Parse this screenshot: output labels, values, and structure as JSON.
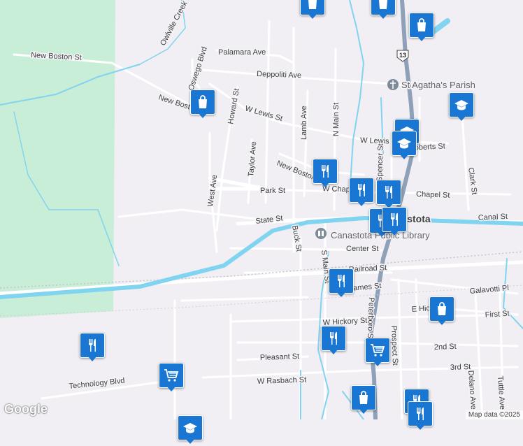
{
  "map": {
    "attribution": "Map data ©2025",
    "logo": "Google",
    "colors": {
      "land": "#f1eff3",
      "park": "#c9eed8",
      "water": "#80d4f0",
      "road": "#ffffff",
      "highway": "#8ea1b8",
      "marker": "#1976d2"
    },
    "streets": [
      "Owlville Creek",
      "New Boston St",
      "Palamara Ave",
      "Deppoliti Ave",
      "Oswego Blvd",
      "Howard St",
      "New Boston St",
      "W Lewis St",
      "W Lewis St",
      "Lamb Ave",
      "N Main St",
      "Taylor Ave",
      "West Ave",
      "Spencer St",
      "Roberts St",
      "New Boston St",
      "W Chapel St",
      "Park St",
      "Chapel St",
      "Clark St",
      "State St",
      "Canal St",
      "Buck St",
      "Center St",
      "Railroad St",
      "S Main St",
      "James St",
      "Galavotti Pl",
      "E Hickory St",
      "Peterboro St",
      "W Hickory St",
      "First St",
      "Prospect St",
      "2nd St",
      "Pleasant St",
      "3rd St",
      "W Rasbach St",
      "Technology Blvd",
      "Delano Ave",
      "Tuttle Ave"
    ],
    "pois": [
      {
        "name": "St Agatha's Parish",
        "icon": "church-icon"
      },
      {
        "name": "Canastota Public Library",
        "icon": "library-icon"
      },
      {
        "name": "Canastota",
        "icon": ""
      }
    ],
    "route_shield": "13",
    "markers": [
      "shopping-bag-icon",
      "shopping-bag-icon",
      "shopping-bag-icon",
      "shopping-bag-icon",
      "graduation-cap-icon",
      "graduation-cap-icon",
      "graduation-cap-icon",
      "restaurant-icon",
      "restaurant-icon",
      "restaurant-icon",
      "restaurant-icon",
      "restaurant-icon",
      "restaurant-icon",
      "restaurant-icon",
      "restaurant-icon",
      "grocery-cart-icon",
      "grocery-cart-icon",
      "shopping-bag-icon",
      "shopping-bag-icon",
      "restaurant-icon",
      "restaurant-icon",
      "graduation-cap-icon"
    ]
  }
}
